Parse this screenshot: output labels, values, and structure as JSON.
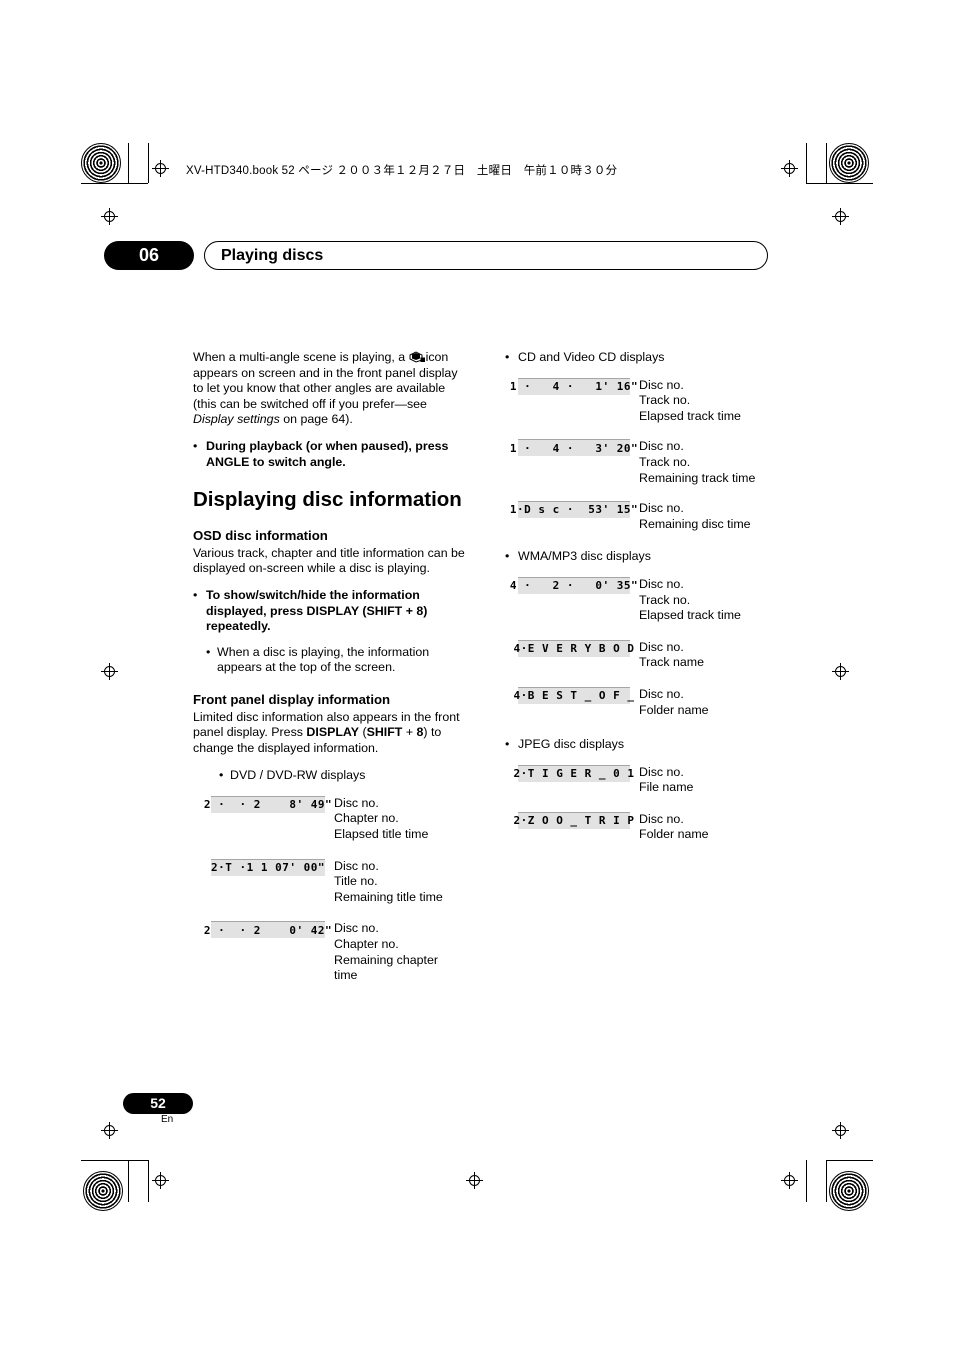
{
  "header": {
    "file_line": "XV-HTD340.book  52 ページ  ２００３年１２月２７日　土曜日　午前１０時３０分"
  },
  "chapter": {
    "number": "06",
    "title": "Playing discs"
  },
  "page": {
    "number": "52",
    "language": "En"
  },
  "left_column": {
    "intro_part1": "When a multi-angle scene is playing, a ",
    "intro_part2": "icon appears on screen and in the front panel display to let you know that other angles are available (this can be switched off if you prefer—see ",
    "intro_italic": "Display settings",
    "intro_part3": " on page 64).",
    "bullet_angle": "During playback (or when paused), press ANGLE to switch angle.",
    "heading_main": "Displaying disc information",
    "heading_osd": "OSD disc information",
    "osd_body": "Various track, chapter and title information can be displayed on-screen while a disc is playing.",
    "bullet_display_1": "To show/switch/hide the information displayed, press DISPLAY (SHIFT + 8) repeatedly.",
    "sub_bullet_display": "When a disc is playing, the information appears at the top of the screen.",
    "heading_front": "Front panel display information",
    "front_body_1": "Limited disc information also appears in the front panel display. Press ",
    "front_body_bold_1": "DISPLAY",
    "front_body_2": " (",
    "front_body_bold_2": "SHIFT",
    "front_body_3": " + ",
    "front_body_bold_3": "8",
    "front_body_4": ") to change the displayed information.",
    "dvd_heading": "DVD / DVD-RW displays",
    "dvd_displays": [
      {
        "panel": "2 ·  · 2    8' 49\"",
        "labels": [
          "Disc no.",
          "Chapter no.",
          "Elapsed title time"
        ]
      },
      {
        "panel": "2·T ·1 1 07' 00\"",
        "labels": [
          "Disc no.",
          "Title no.",
          "Remaining title time"
        ]
      },
      {
        "panel": "2 ·  · 2    0' 42\"",
        "labels": [
          "Disc no.",
          "Chapter no.",
          "Remaining chapter",
          "time"
        ]
      }
    ]
  },
  "right_column": {
    "cd_heading": "CD and Video CD displays",
    "cd_displays": [
      {
        "panel": "1 ·   4 ·   1' 16\"",
        "labels": [
          "Disc no.",
          "Track no.",
          "Elapsed track time"
        ]
      },
      {
        "panel": "1 ·   4 ·   3' 20\"",
        "labels": [
          "Disc no.",
          "Track no.",
          "Remaining track time"
        ]
      },
      {
        "panel": "1·D s c ·  53' 15\"",
        "labels": [
          "Disc no.",
          "Remaining disc time"
        ]
      }
    ],
    "wma_heading": "WMA/MP3 disc displays",
    "wma_displays": [
      {
        "panel": "4 ·   2 ·   0' 35\"",
        "labels": [
          "Disc no.",
          "Track no.",
          "Elapsed track time"
        ]
      },
      {
        "panel": "4·E V E R Y B O D",
        "labels": [
          "Disc no.",
          "Track name"
        ]
      },
      {
        "panel": "4·B E S T _ O F _",
        "labels": [
          "Disc no.",
          "Folder name"
        ]
      }
    ],
    "jpeg_heading": "JPEG disc displays",
    "jpeg_displays": [
      {
        "panel": "2·T I G E R _ 0 1",
        "labels": [
          "Disc no.",
          "File name"
        ]
      },
      {
        "panel": "2·Z O O _ T R I P",
        "labels": [
          "Disc no.",
          "Folder name"
        ]
      }
    ]
  }
}
